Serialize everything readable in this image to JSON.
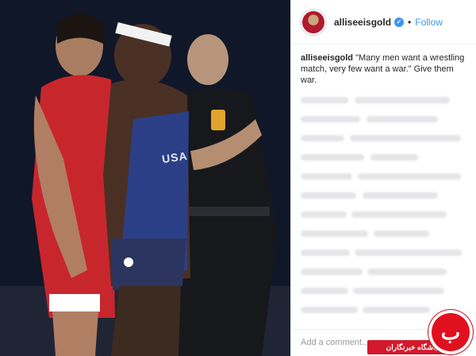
{
  "post": {
    "username": "alliseeisgold",
    "verified_symbol": "✓",
    "separator": "•",
    "follow_label": "Follow",
    "caption_user": "alliseeisgold",
    "caption_text": " \"Many men want a wrestling match, very few want a war.\" Give them war.",
    "add_comment_placeholder": "Add a comment..."
  },
  "photo": {
    "jersey_text": "USA"
  },
  "watermark": {
    "label": "باشگاه خبرنگاران",
    "logo_glyph": "ب"
  },
  "colors": {
    "accent": "#3897f0",
    "red_singlet": "#c8262d",
    "blue_singlet": "#2a3f86",
    "watermark_red": "#d3192b"
  }
}
